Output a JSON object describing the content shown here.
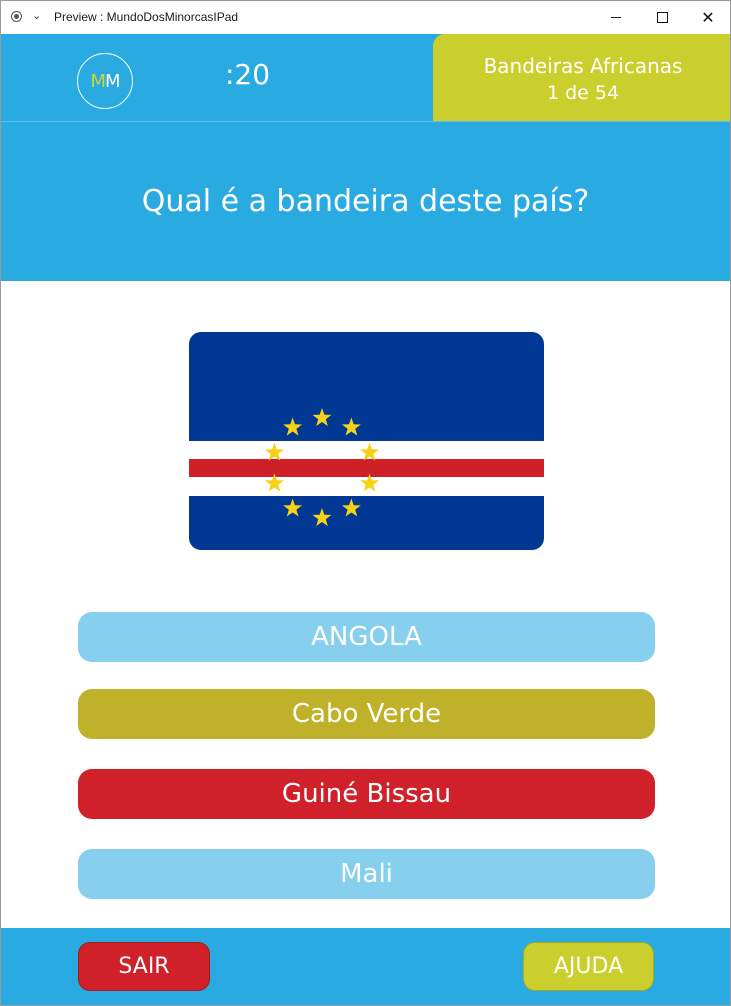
{
  "window": {
    "title": "Preview : MundoDosMinorcasIPad",
    "chevron_glyph": "⌄",
    "close_glyph": "✕"
  },
  "header": {
    "logo_m1": "M",
    "logo_m2": "M",
    "timer": ":20",
    "topic_title": "Bandeiras Africanas",
    "topic_count": "1 de 54",
    "question": "Qual é a bandeira deste país?"
  },
  "flag": {
    "icon": "cape-verde-flag",
    "colors": {
      "blue": "#003893",
      "white": "#ffffff",
      "red": "#cf2027",
      "star": "#f7d116"
    },
    "star_count": 10
  },
  "answers": [
    {
      "label": "ANGOLA",
      "color": "#87cfef"
    },
    {
      "label": "Cabo Verde",
      "color": "#bfb22a"
    },
    {
      "label": "Guiné Bissau",
      "color": "#d0202a"
    },
    {
      "label": "Mali",
      "color": "#87cfef"
    }
  ],
  "footer": {
    "exit_label": "SAIR",
    "help_label": "AJUDA"
  },
  "colors": {
    "header_blue": "#29abe2",
    "accent_yellow": "#cbcf2e"
  }
}
